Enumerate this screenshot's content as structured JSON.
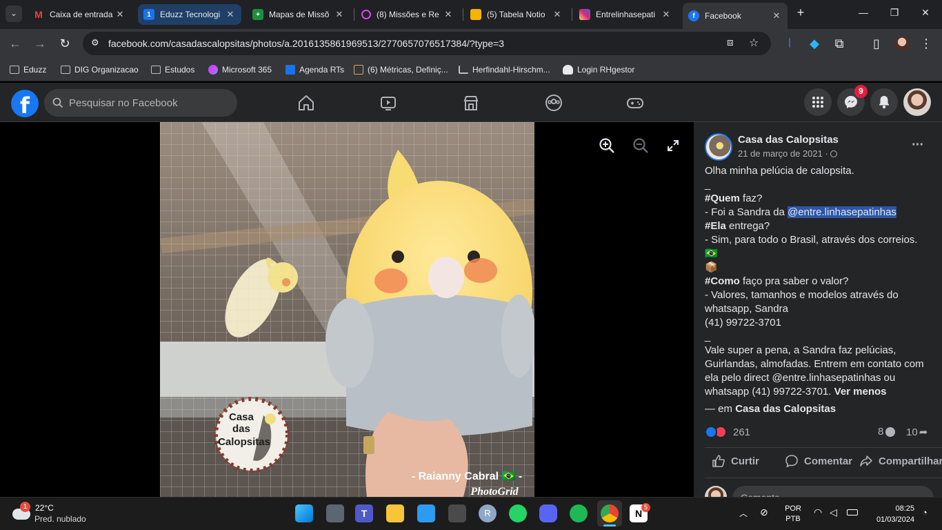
{
  "browser": {
    "tabs": [
      {
        "title": "Caixa de entrada",
        "icon": "gmail-icon",
        "color": "#ea4335"
      },
      {
        "title": "Eduzz Tecnologi",
        "icon": "calendar-icon",
        "color": "#1a73e8"
      },
      {
        "title": "Mapas de Missõ",
        "icon": "sheets-icon",
        "color": "#1e8e3e"
      },
      {
        "title": "(8) Missões e Re",
        "icon": "target-icon",
        "color": "#e040fb"
      },
      {
        "title": "(5) Tabela Notio",
        "icon": "people-icon",
        "color": "#f4b400"
      },
      {
        "title": "Entrelinhasepati",
        "icon": "instagram-icon",
        "color": "#e1306c"
      },
      {
        "title": "Facebook",
        "icon": "facebook-icon",
        "color": "#1877f2"
      }
    ],
    "url": "facebook.com/casadascalopsitas/photos/a.2016135861969513/2770657076517384/?type=3",
    "bookmarks": [
      {
        "label": "Eduzz"
      },
      {
        "label": "DIG Organizacao"
      },
      {
        "label": "Estudos"
      },
      {
        "label": "Microsoft 365"
      },
      {
        "label": "Agenda RTs"
      },
      {
        "label": "(6) Métricas, Definiç..."
      },
      {
        "label": "Herfindahl-Hirschm..."
      },
      {
        "label": "Login RHgestor"
      }
    ]
  },
  "facebook": {
    "logo": "f",
    "search_placeholder": "Pesquisar no Facebook",
    "messenger_badge": "9"
  },
  "photo": {
    "stamp": [
      "Casa",
      "das",
      "Calopsitas"
    ],
    "watermark": "- Raianny Cabral 🇧🇷 -",
    "app_mark": "PhotoGrid"
  },
  "post": {
    "page_name": "Casa das Calopsitas",
    "date": "21 de março de 2021 · ",
    "lines": {
      "l1": "Olha minha pelúcia de calopsita.",
      "l2": "_",
      "l3a": "#Quem",
      "l3b": " faz?",
      "l4a": "- Foi a Sandra da ",
      "l4b": "@entre.linhasepatinhas",
      "l5a": "#Ela",
      "l5b": " entrega?",
      "l6": "- Sim, para todo o Brasil, através dos correios. 🇧🇷",
      "l7": "📦",
      "l8a": "#Como",
      "l8b": " faço pra saber o valor?",
      "l9": "- Valores, tamanhos e modelos através do",
      "l10": "whatsapp, Sandra",
      "l11": "(41) 99722-3701",
      "l12": "_",
      "l13": "Vale super a pena, a Sandra faz pelúcias,",
      "l14": "Guirlandas, almofadas. Entrem em contato com",
      "l15": "ela pelo direct @entre.linhasepatinhas ou",
      "l16a": "whatsapp (41) 99722-3701. ",
      "l16b": "Ver menos"
    },
    "tagline_prefix": "— em ",
    "tagline_page": "Casa das Calopsitas",
    "reactions_count": "261",
    "comments_count": "8",
    "shares_count": "10",
    "actions": {
      "like": "Curtir",
      "comment": "Comentar",
      "share": "Compartilhar"
    },
    "comment_placeholder": "Comente..."
  },
  "taskbar": {
    "weather_temp": "22°C",
    "weather_desc": "Pred. nublado",
    "weather_badge": "1",
    "lang_top": "POR",
    "lang_bottom": "PTB",
    "time": "08:25",
    "date": "01/03/2024",
    "notion_badge": "5"
  },
  "colors": {
    "fb_blue": "#1877f2",
    "fb_dark": "#242526",
    "mention_bg": "#2d57a8",
    "badge_red": "#e41e3f"
  }
}
